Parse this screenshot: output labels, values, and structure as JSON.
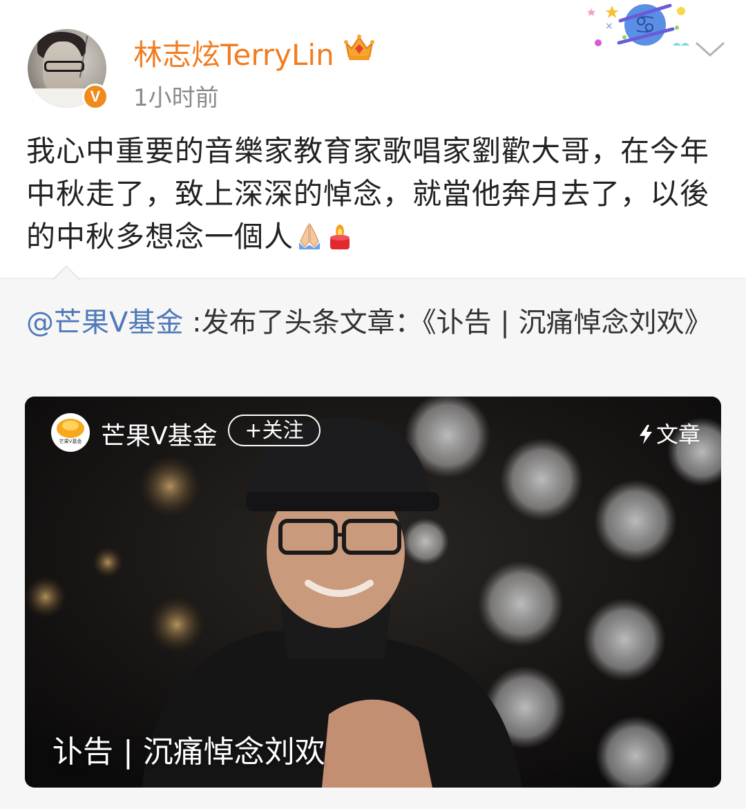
{
  "author": {
    "name": "林志炫TerryLin",
    "time": "1小时前",
    "verified_badge": "V",
    "avatar_icon": "avatar-photo",
    "vip_icon": "crown-icon"
  },
  "post": {
    "text": "我心中重要的音樂家教育家歌唱家劉歡大哥，在今年中秋走了，致上深深的悼念，就當他奔月去了，以後的中秋多想念一個人",
    "emojis": [
      "praying-hands-icon",
      "candle-icon"
    ]
  },
  "repost": {
    "mention": "@芒果V基金",
    "text": ":发布了头条文章：《讣告 | 沉痛悼念刘欢》"
  },
  "card": {
    "source_name": "芒果V基金",
    "follow_label": "+关注",
    "tag_label": "文章",
    "title": "讣告 | 沉痛悼念刘欢",
    "logo_icon": "mango-logo-icon"
  },
  "colors": {
    "username": "#f27c1f",
    "mention": "#4f79b8",
    "badge": "#f08a1c",
    "repost_bg": "#f6f6f6"
  }
}
